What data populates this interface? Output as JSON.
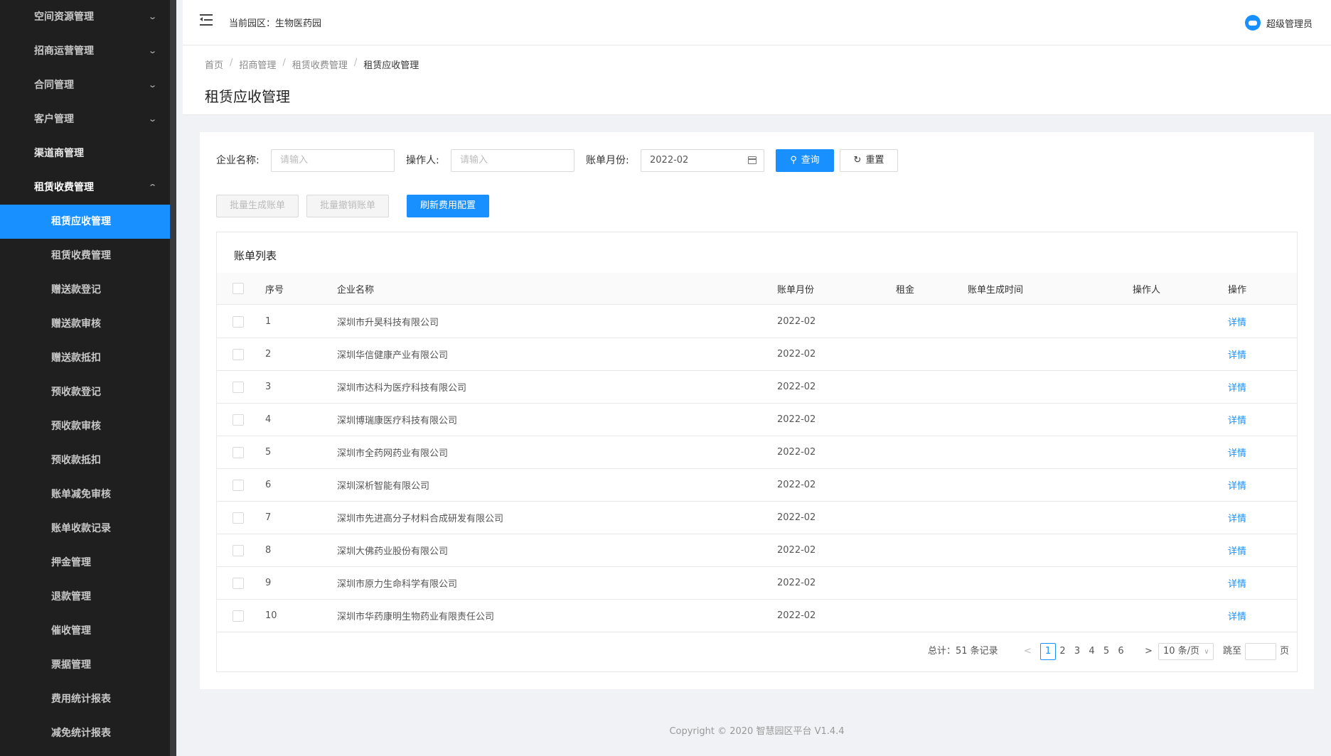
{
  "sidebar": {
    "items": [
      {
        "label": "空间资源管理",
        "chev": "⌄"
      },
      {
        "label": "招商运营管理",
        "chev": "⌄"
      },
      {
        "label": "合同管理",
        "chev": "⌄"
      },
      {
        "label": "客户管理",
        "chev": "⌄"
      },
      {
        "label": "渠道商管理",
        "chev": ""
      },
      {
        "label": "租赁收费管理",
        "chev": "⌃"
      }
    ],
    "subitems": [
      "租赁应收管理",
      "租赁收费管理",
      "赠送款登记",
      "赠送款审核",
      "赠送款抵扣",
      "预收款登记",
      "预收款审核",
      "预收款抵扣",
      "账单减免审核",
      "账单收款记录",
      "押金管理",
      "退款管理",
      "催收管理",
      "票据管理",
      "费用统计报表",
      "减免统计报表"
    ]
  },
  "header": {
    "park_label": "当前园区：生物医药园",
    "user_name": "超级管理员"
  },
  "breadcrumb": [
    "首页",
    "招商管理",
    "租赁收费管理",
    "租赁应收管理"
  ],
  "breadcrumb_sep": "/",
  "page_title": "租赁应收管理",
  "filters": {
    "company_label": "企业名称:",
    "company_placeholder": "请输入",
    "operator_label": "操作人:",
    "operator_placeholder": "请输入",
    "month_label": "账单月份:",
    "month_value": "2022-02",
    "search_label": "查询",
    "reset_label": "重置"
  },
  "actions": {
    "batch_generate": "批量生成账单",
    "batch_cancel": "批量撤销账单",
    "refresh_config": "刷新费用配置"
  },
  "table": {
    "title": "账单列表",
    "columns": [
      "序号",
      "企业名称",
      "账单月份",
      "租金",
      "账单生成时间",
      "操作人",
      "操作"
    ],
    "rows": [
      {
        "no": "1",
        "company": "深圳市升昊科技有限公司",
        "month": "2022-02",
        "rent": "",
        "time": "",
        "operator": "",
        "action": "详情"
      },
      {
        "no": "2",
        "company": "深圳华信健康产业有限公司",
        "month": "2022-02",
        "rent": "",
        "time": "",
        "operator": "",
        "action": "详情"
      },
      {
        "no": "3",
        "company": "深圳市达科为医疗科技有限公司",
        "month": "2022-02",
        "rent": "",
        "time": "",
        "operator": "",
        "action": "详情"
      },
      {
        "no": "4",
        "company": "深圳博瑞康医疗科技有限公司",
        "month": "2022-02",
        "rent": "",
        "time": "",
        "operator": "",
        "action": "详情"
      },
      {
        "no": "5",
        "company": "深圳市全药网药业有限公司",
        "month": "2022-02",
        "rent": "",
        "time": "",
        "operator": "",
        "action": "详情"
      },
      {
        "no": "6",
        "company": "深圳深析智能有限公司",
        "month": "2022-02",
        "rent": "",
        "time": "",
        "operator": "",
        "action": "详情"
      },
      {
        "no": "7",
        "company": "深圳市先进高分子材料合成研发有限公司",
        "month": "2022-02",
        "rent": "",
        "time": "",
        "operator": "",
        "action": "详情"
      },
      {
        "no": "8",
        "company": "深圳大佛药业股份有限公司",
        "month": "2022-02",
        "rent": "",
        "time": "",
        "operator": "",
        "action": "详情"
      },
      {
        "no": "9",
        "company": "深圳市原力生命科学有限公司",
        "month": "2022-02",
        "rent": "",
        "time": "",
        "operator": "",
        "action": "详情"
      },
      {
        "no": "10",
        "company": "深圳市华药康明生物药业有限责任公司",
        "month": "2022-02",
        "rent": "",
        "time": "",
        "operator": "",
        "action": "详情"
      }
    ]
  },
  "pagination": {
    "total_text": "总计：51 条记录",
    "prev": "<",
    "next": ">",
    "pages": [
      "1",
      "2",
      "3",
      "4",
      "5",
      "6"
    ],
    "current": "1",
    "page_size": "10 条/页",
    "jump_label": "跳至",
    "page_suffix": "页"
  },
  "footer": "Copyright © 2020 智慧园区平台 V1.4.4",
  "colors": {
    "primary": "#1890ff",
    "sidebar_bg": "#1f1f1f"
  }
}
